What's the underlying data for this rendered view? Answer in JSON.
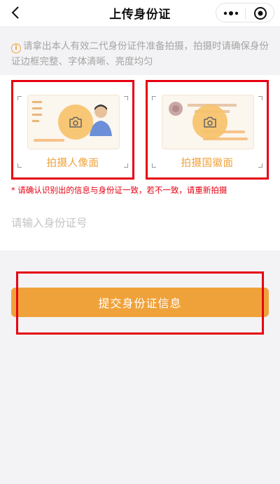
{
  "header": {
    "title": "上传身份证",
    "more_icon": "more-dots-icon",
    "close_icon": "target-close-icon",
    "back_icon": "back-arrow-icon"
  },
  "notice": {
    "icon": "info-icon",
    "text": "请拿出本人有效二代身份证件准备拍摄，拍摄时请确保身份证边框完整、字体清晰、亮度均匀"
  },
  "upload": {
    "front": {
      "label": "拍摄人像面",
      "icon": "camera-icon"
    },
    "back": {
      "label": "拍摄国徽面",
      "icon": "camera-icon"
    }
  },
  "warning": "* 请确认识别出的信息与身份证一致，若不一致，请重新拍摄",
  "id_input": {
    "placeholder": "请输入身份证号",
    "value": ""
  },
  "submit": {
    "label": "提交身份证信息"
  },
  "colors": {
    "accent": "#f0a23a",
    "warning": "#e60012",
    "highlight": "#e60012"
  }
}
